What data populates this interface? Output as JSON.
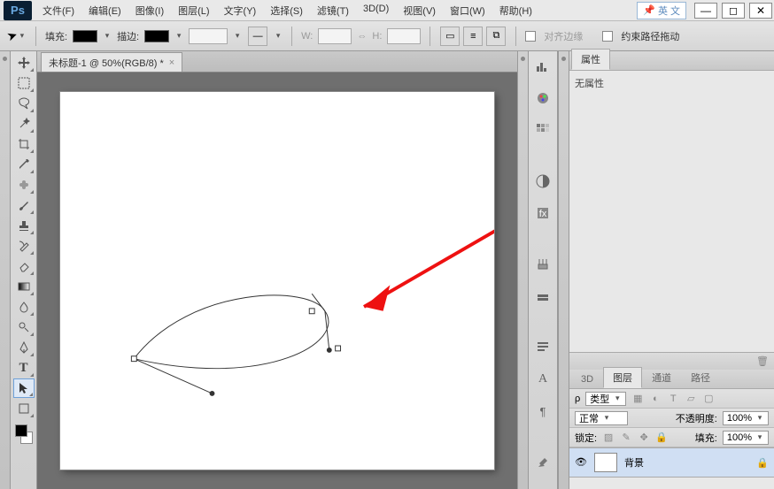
{
  "app": {
    "name": "Ps"
  },
  "menu": {
    "file": "文件(F)",
    "edit": "编辑(E)",
    "image": "图像(I)",
    "layer": "图层(L)",
    "type": "文字(Y)",
    "select": "选择(S)",
    "filter": "滤镜(T)",
    "threeD": "3D(D)",
    "view": "视图(V)",
    "window": "窗口(W)",
    "help": "帮助(H)"
  },
  "lang": {
    "text": "英 文"
  },
  "options": {
    "fill_label": "填充:",
    "stroke_label": "描边:",
    "stroke_width": "",
    "w_label": "W:",
    "h_label": "H:",
    "align_label": "对齐边缘",
    "constrain_label": "约束路径拖动"
  },
  "document": {
    "tab_title": "未标题-1 @ 50%(RGB/8) *"
  },
  "panels": {
    "properties_tab": "属性",
    "no_properties": "无属性",
    "threeD_tab": "3D",
    "layers_tab": "图层",
    "channels_tab": "通道",
    "paths_tab": "路径",
    "kind_label": "类型",
    "blend_mode": "正常",
    "opacity_label": "不透明度:",
    "opacity_value": "100%",
    "lock_label": "锁定:",
    "fill_label": "填充:",
    "fill_value": "100%",
    "background_layer": "背景"
  }
}
